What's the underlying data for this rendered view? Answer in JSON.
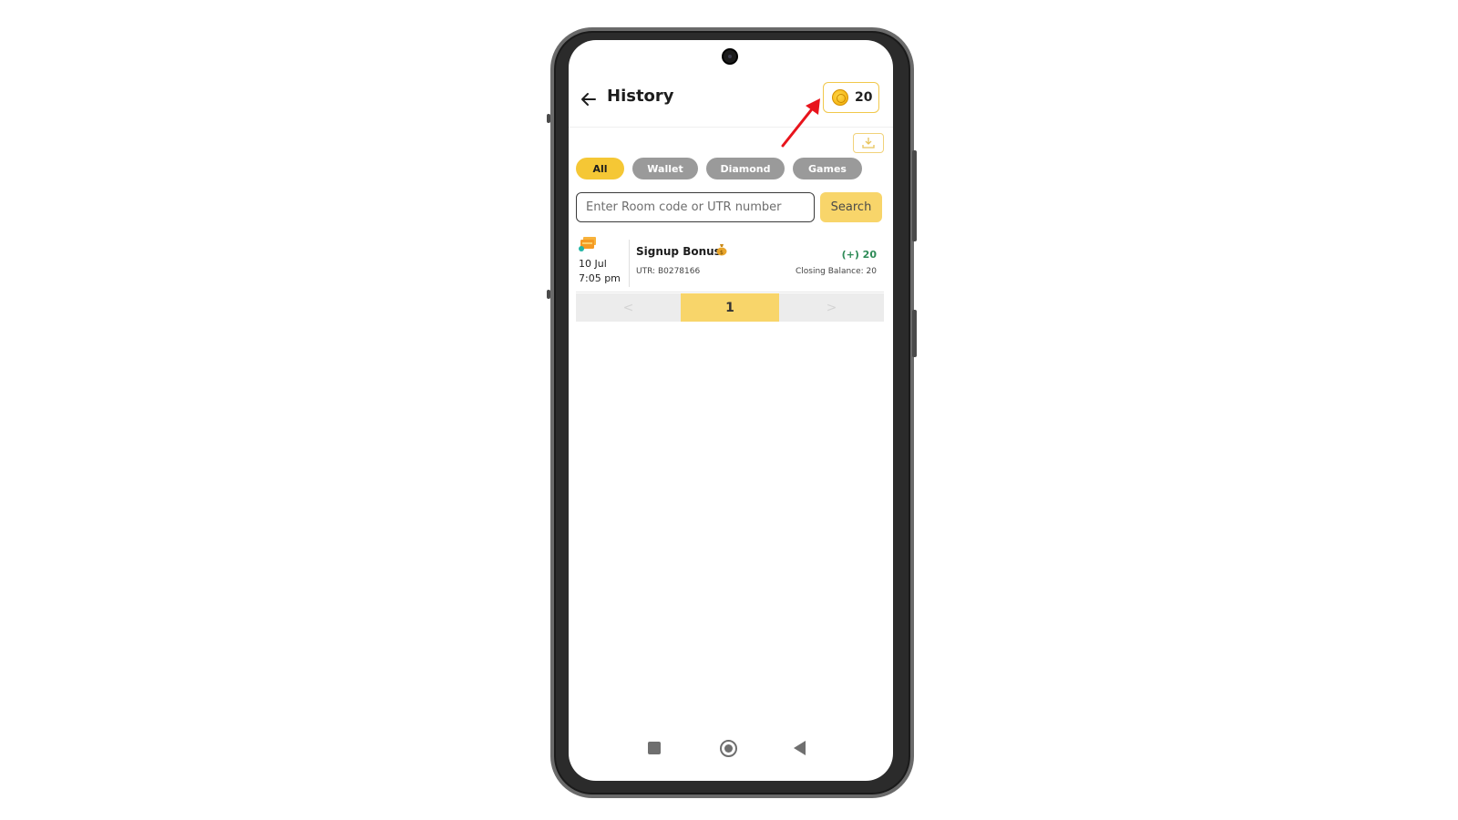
{
  "header": {
    "title": "History",
    "coin_balance": "20",
    "back_icon": "arrow-left-icon",
    "coin_icon": "coin-icon"
  },
  "download_icon": "download-icon",
  "tabs": [
    {
      "label": "All",
      "active": true
    },
    {
      "label": "Wallet",
      "active": false
    },
    {
      "label": "Diamond",
      "active": false
    },
    {
      "label": "Games",
      "active": false
    }
  ],
  "search": {
    "placeholder": "Enter Room code or UTR number",
    "value": "",
    "button_label": "Search"
  },
  "transactions": [
    {
      "icon": "wallet-cash-icon",
      "date": "10 Jul",
      "time": "7:05 pm",
      "title": "Signup Bonus",
      "title_emoji": "money-bag-icon",
      "utr": "UTR: B0278166",
      "amount": "(+) 20",
      "closing_balance": "Closing Balance: 20"
    }
  ],
  "pagination": {
    "prev_label": "<",
    "current_page": "1",
    "next_label": ">"
  },
  "colors": {
    "accent_yellow": "#f5c735",
    "tab_inactive": "#9a9a9a",
    "credit_green": "#2e8b57",
    "annotation_red": "#e8141c"
  }
}
